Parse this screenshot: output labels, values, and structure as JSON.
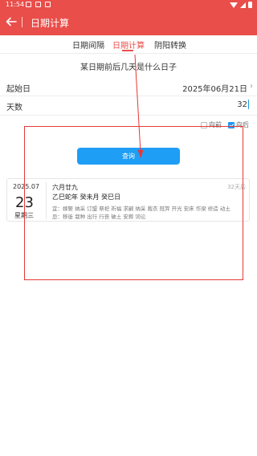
{
  "status_bar": {
    "time": "11:54",
    "notification_icons": [
      "image-icon",
      "image-icon",
      "calendar-icon"
    ],
    "system_icons": [
      "wifi-icon",
      "signal-icon",
      "battery-icon"
    ]
  },
  "app_bar": {
    "title": "日期计算",
    "back_icon": "arrow-left-icon",
    "background": "#e94e4a"
  },
  "tabs": [
    {
      "label": "日期间隔",
      "active": false
    },
    {
      "label": "日期计算",
      "active": true
    },
    {
      "label": "阴阳转换",
      "active": false
    }
  ],
  "question": "某日期前后几天是什么日子",
  "form": {
    "start_label": "起始日",
    "start_value": "2025年06月21日",
    "days_label": "天数",
    "days_value": "32",
    "option_before": "向前",
    "option_before_checked": false,
    "option_after": "向后",
    "option_after_checked": true
  },
  "query_button": "查询",
  "result": {
    "year_month": "2025.07",
    "day": "23",
    "weekday": "星期三",
    "lunar_date": "六月廿九",
    "ganzhi": "乙巳蛇年 癸未月 癸巳日",
    "offset_label": "32天后",
    "yi": "宜：嫁娶 纳采 订盟 祭祀 祈福 求嗣 纳采 裁衣 冠笄 开光 安床 作梁 修造 动土",
    "ji": "忌：移徙 栽种 出行 行丧 破土 安葬 词讼"
  },
  "colors": {
    "accent": "#e94e4a",
    "button": "#1e9ef5",
    "annotation": "#e53935"
  }
}
